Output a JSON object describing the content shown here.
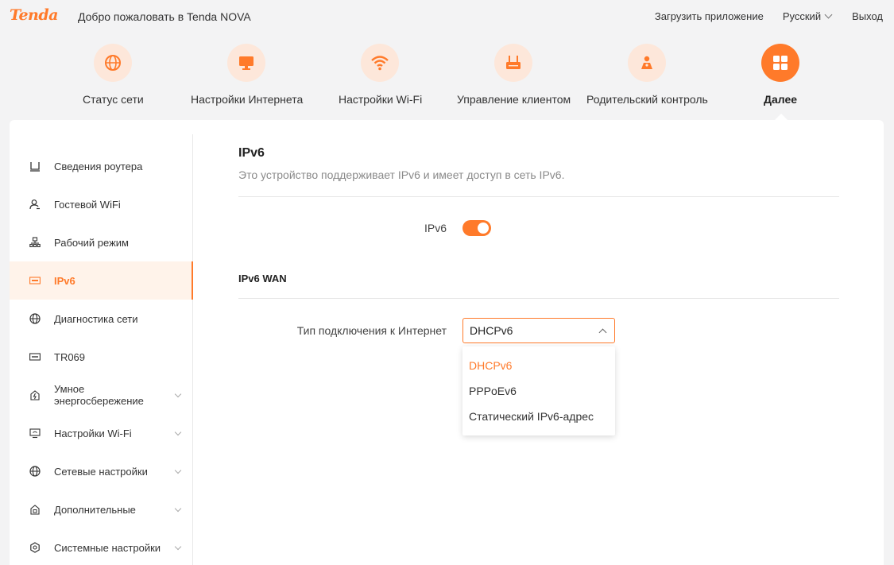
{
  "header": {
    "logo": "Tenda",
    "welcome": "Добро пожаловать в Tenda NOVA",
    "download_app": "Загрузить приложение",
    "language": "Русский",
    "logout": "Выход"
  },
  "colors": {
    "accent": "#ff7a2a",
    "accent_light": "#fde7da"
  },
  "mainnav": [
    {
      "label": "Статус сети",
      "icon": "globe-icon"
    },
    {
      "label": "Настройки Интернета",
      "icon": "monitor-icon"
    },
    {
      "label": "Настройки Wi-Fi",
      "icon": "wifi-icon"
    },
    {
      "label": "Управление клиентом",
      "icon": "router-icon"
    },
    {
      "label": "Родительский контроль",
      "icon": "parent-icon"
    },
    {
      "label": "Далее",
      "icon": "grid-icon",
      "active": true
    }
  ],
  "sidebar": {
    "items": [
      {
        "label": "Сведения роутера",
        "icon": "router-info-icon"
      },
      {
        "label": "Гостевой WiFi",
        "icon": "guest-icon"
      },
      {
        "label": "Рабочий режим",
        "icon": "work-mode-icon"
      },
      {
        "label": "IPv6",
        "icon": "ipv6-icon",
        "active": true
      },
      {
        "label": "Диагностика сети",
        "icon": "globe-icon"
      },
      {
        "label": "TR069",
        "icon": "tr069-icon"
      },
      {
        "label": "Умное энергосбережение",
        "label_line1": "Умное",
        "label_line2": "энергосбережение",
        "icon": "energy-icon",
        "expandable": true
      },
      {
        "label": "Настройки Wi-Fi",
        "icon": "wifi-settings-icon",
        "expandable": true
      },
      {
        "label": "Сетевые настройки",
        "icon": "globe-icon",
        "expandable": true
      },
      {
        "label": "Дополнительные",
        "icon": "lock-icon",
        "expandable": true
      },
      {
        "label": "Системные настройки",
        "icon": "gear-icon",
        "expandable": true
      }
    ]
  },
  "main": {
    "title": "IPv6",
    "description": "Это устройство поддерживает IPv6 и имеет доступ в сеть IPv6.",
    "ipv6_label": "IPv6",
    "ipv6_enabled": true,
    "wan_section_title": "IPv6 WAN",
    "connection_type_label": "Тип подключения к Интернет",
    "connection_type_value": "DHCPv6",
    "connection_options": [
      "DHCPv6",
      "PPPoEv6",
      "Статический IPv6-адрес"
    ]
  }
}
